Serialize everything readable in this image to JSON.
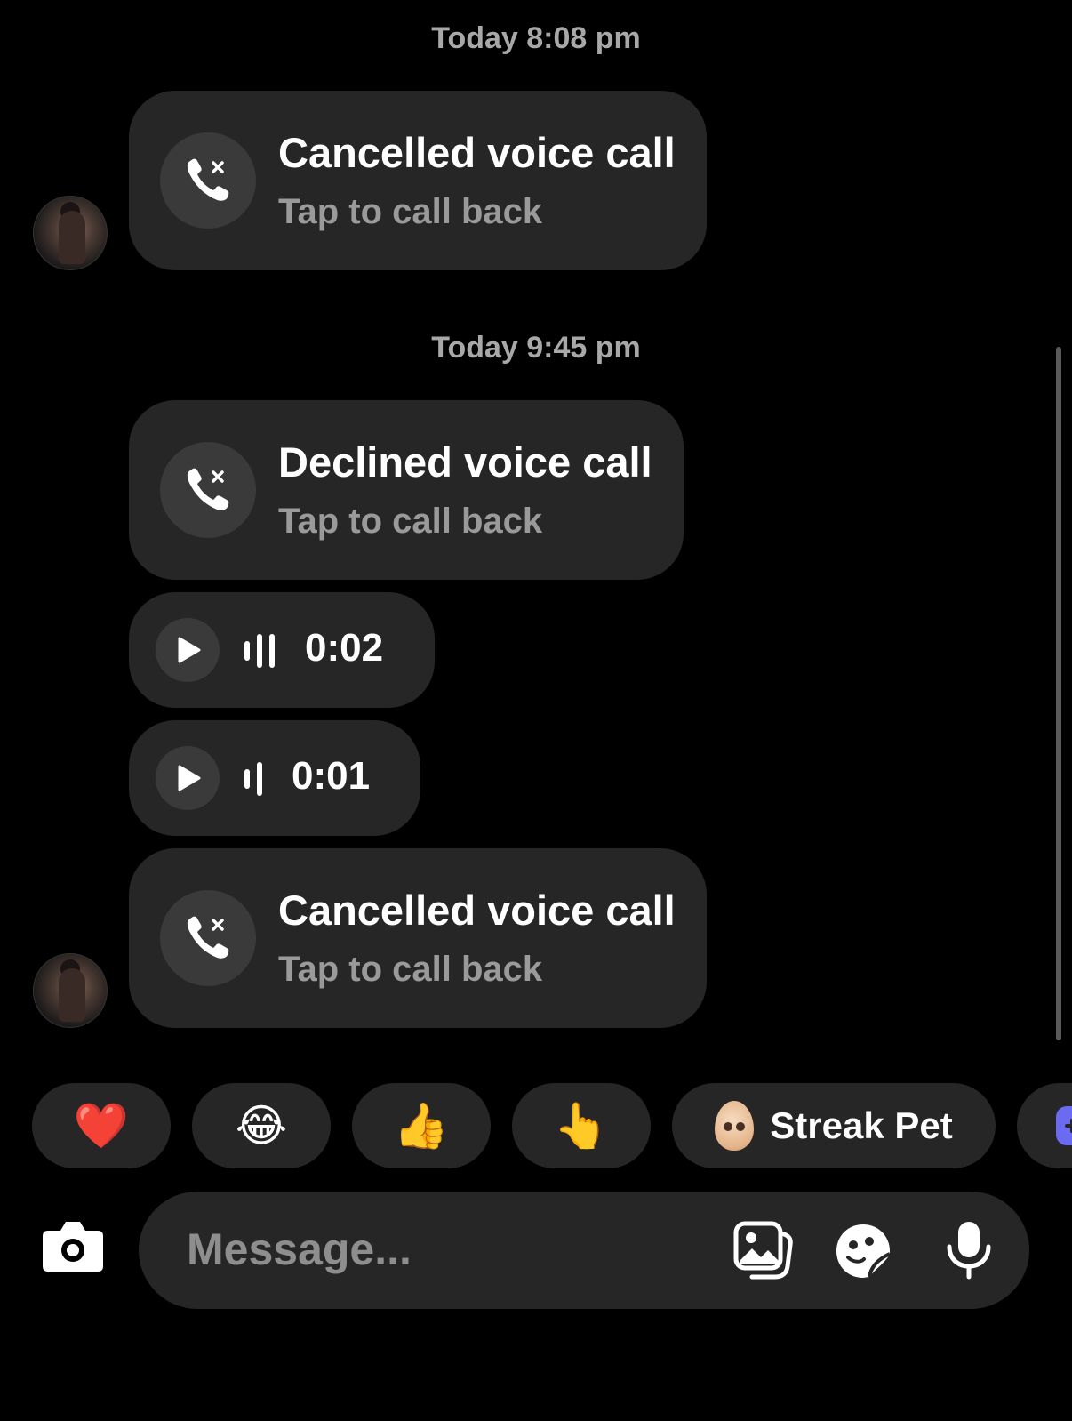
{
  "thread": {
    "groups": [
      {
        "timestamp": "Today 8:08 pm",
        "messages": [
          {
            "kind": "call",
            "title": "Cancelled voice call",
            "subtitle": "Tap to call back",
            "icon": "missed-call-icon"
          }
        ]
      },
      {
        "timestamp": "Today 9:45 pm",
        "messages": [
          {
            "kind": "call",
            "title": "Declined voice call",
            "subtitle": "Tap to call back",
            "icon": "missed-call-icon"
          },
          {
            "kind": "voice",
            "duration": "0:02",
            "icon": "play-icon"
          },
          {
            "kind": "voice",
            "duration": "0:01",
            "icon": "play-icon"
          },
          {
            "kind": "call",
            "title": "Cancelled voice call",
            "subtitle": "Tap to call back",
            "icon": "missed-call-icon"
          }
        ]
      }
    ]
  },
  "quick_replies": [
    {
      "emoji": "❤️",
      "name": "heart"
    },
    {
      "emoji": "😂",
      "name": "laughing"
    },
    {
      "emoji": "👍",
      "name": "thumbs-up"
    },
    {
      "emoji": "👆",
      "name": "pointing"
    },
    {
      "label": "Streak Pet",
      "icon": "egg-icon"
    }
  ],
  "composer": {
    "placeholder": "Message...",
    "icons": [
      "camera-icon",
      "gallery-icon",
      "sticker-icon",
      "microphone-icon"
    ]
  },
  "colors": {
    "background": "#000000",
    "bubble": "#262626",
    "muted_text": "#9a9a9a"
  }
}
